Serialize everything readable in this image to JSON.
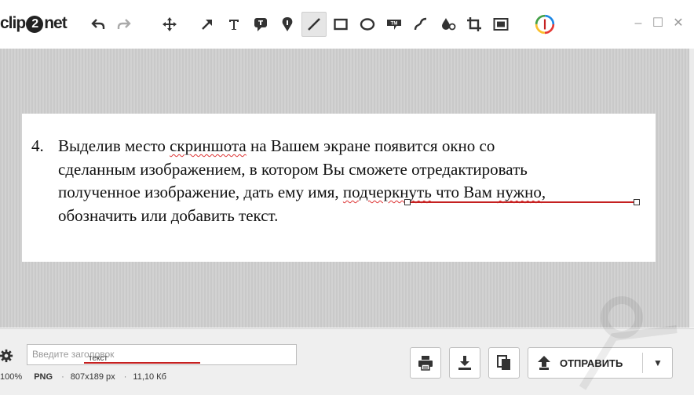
{
  "app": {
    "logo": "clip2net"
  },
  "toolbar": {
    "tools": [
      "undo-icon",
      "redo-icon",
      "move-icon",
      "arrow-icon",
      "text-icon",
      "callout-icon",
      "pin-icon",
      "line-icon",
      "rectangle-icon",
      "ellipse-icon",
      "stamp-icon",
      "curve-icon",
      "blur-icon",
      "crop-icon",
      "resize-icon",
      "color-picker-icon"
    ],
    "active_tool": "line-icon",
    "accent": "#c52020"
  },
  "document": {
    "item_number": "4.",
    "line1_a": "Выделив место ",
    "line1_b": "скриншота",
    "line1_c": " на Вашем экране появится окно со",
    "line2": "сделанным изображением, в котором Вы сможете отредактировать",
    "line3_a": "полученное изображение, дать ему имя, ",
    "line3_b": "подчеркнуть",
    "line3_c": " что Вам ",
    "line3_d": "нужно",
    "line3_e": ",",
    "line4": "обозначить или добавить текст."
  },
  "bottom": {
    "title_placeholder": "Введите заголовок",
    "typed_text": "текст",
    "zoom": "100%",
    "format": "PNG",
    "dimensions": "807x189 px",
    "filesize": "11,10 Кб",
    "send_label": "ОТПРАВИТЬ"
  }
}
